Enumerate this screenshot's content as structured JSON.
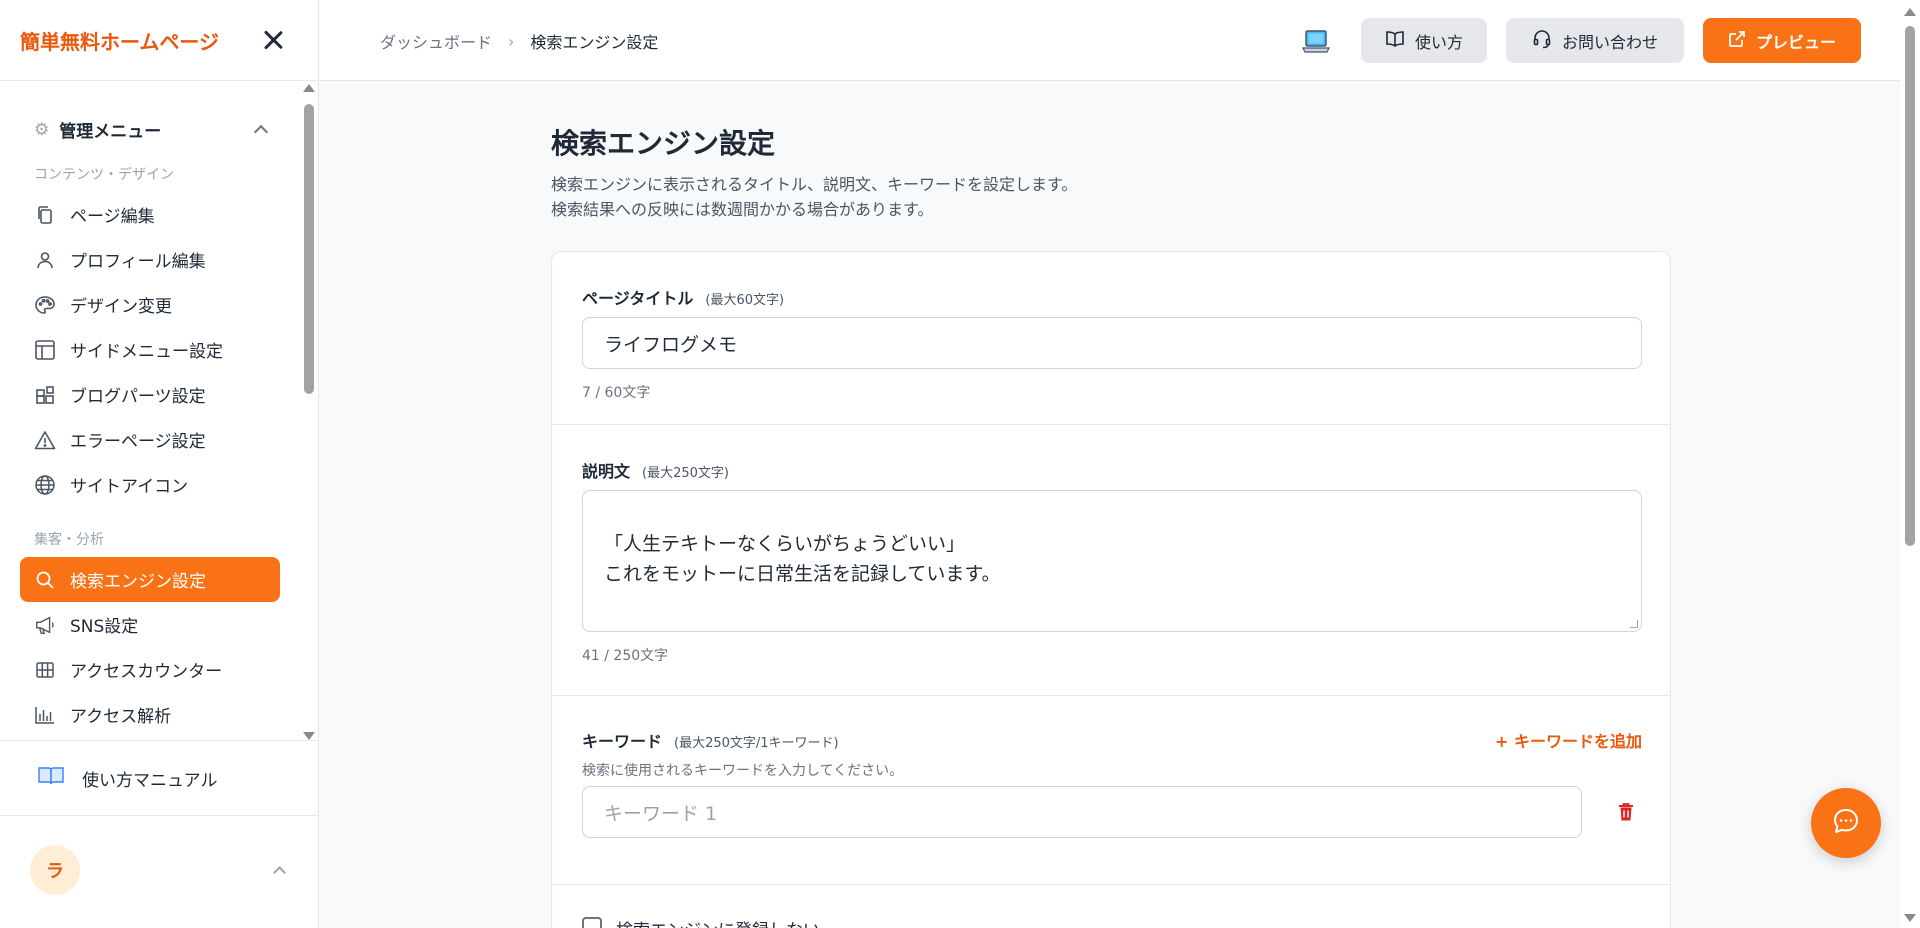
{
  "sidebar": {
    "brand": "簡単無料ホームページ",
    "menu_title": "管理メニュー",
    "section1": "コンテンツ・デザイン",
    "items1": [
      {
        "label": "ページ編集",
        "icon": "copy-icon"
      },
      {
        "label": "プロフィール編集",
        "icon": "user-icon"
      },
      {
        "label": "デザイン変更",
        "icon": "palette-icon"
      },
      {
        "label": "サイドメニュー設定",
        "icon": "layout-icon"
      },
      {
        "label": "ブログパーツ設定",
        "icon": "blocks-icon"
      },
      {
        "label": "エラーページ設定",
        "icon": "warning-icon"
      },
      {
        "label": "サイトアイコン",
        "icon": "globe-icon"
      }
    ],
    "section2": "集客・分析",
    "items2": [
      {
        "label": "検索エンジン設定",
        "icon": "search-icon",
        "active": true
      },
      {
        "label": "SNS設定",
        "icon": "megaphone-icon"
      },
      {
        "label": "アクセスカウンター",
        "icon": "grid-icon"
      },
      {
        "label": "アクセス解析",
        "icon": "bar-chart-icon"
      }
    ],
    "manual": "使い方マニュアル",
    "user_initial": "ラ"
  },
  "topbar": {
    "breadcrumb_root": "ダッシュボード",
    "breadcrumb_current": "検索エンジン設定",
    "guide_button": "使い方",
    "contact_button": "お問い合わせ",
    "preview_button": "プレビュー"
  },
  "main": {
    "title": "検索エンジン設定",
    "desc_line1": "検索エンジンに表示されるタイトル、説明文、キーワードを設定します。",
    "desc_line2": "検索結果への反映には数週間かかる場合があります。",
    "page_title_label": "ページタイトル",
    "page_title_hint": "(最大60文字)",
    "page_title_value": "ライフログメモ",
    "page_title_count": "7 / 60文字",
    "description_label": "説明文",
    "description_hint": "(最大250文字)",
    "description_value": "「人生テキトーなくらいがちょうどいい」\nこれをモットーに日常生活を記録しています。",
    "description_count": "41 / 250文字",
    "keyword_label": "キーワード",
    "keyword_hint": "(最大250文字/1キーワード)",
    "add_keyword": "+ キーワードを追加",
    "keyword_help": "検索に使用されるキーワードを入力してください。",
    "keyword_placeholder": "キーワード 1",
    "no_index_label": "検索エンジンに登録しない"
  },
  "colors": {
    "accent": "#f97316",
    "brand_text": "#ea580c",
    "trash": "#dc2626"
  }
}
